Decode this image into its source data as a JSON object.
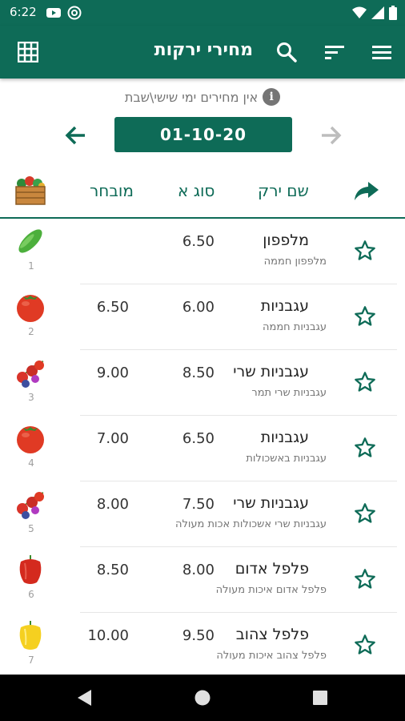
{
  "status_bar": {
    "time": "6:22",
    "icons_left": [
      "youtube-icon",
      "at-sign-icon"
    ],
    "icons_right": [
      "wifi-icon",
      "cellular-signal-icon",
      "battery-icon"
    ]
  },
  "app_bar": {
    "title": "מחירי ירקות",
    "icons": [
      "grid-icon",
      "search-icon",
      "sort-icon",
      "menu-icon"
    ],
    "color": "#0e6b57"
  },
  "notice": {
    "text": "אין מחירים ימי שישי\\שבת"
  },
  "date_nav": {
    "date": "01-10-20"
  },
  "table_header": {
    "col_name": "שם ירק",
    "col_grade_a": "סוג א",
    "col_selected": "מובחר"
  },
  "rows": [
    {
      "num": "1",
      "icon": "cucumber",
      "name": "מלפפון",
      "sub": "מלפפון חממה",
      "grade_a": "6.50",
      "selected": ""
    },
    {
      "num": "2",
      "icon": "tomato",
      "name": "עגבניות",
      "sub": "עגבניות חממה",
      "grade_a": "6.00",
      "selected": "6.50"
    },
    {
      "num": "3",
      "icon": "cherry-tomato",
      "name": "עגבניות שרי",
      "sub": "עגבניות שרי תמר",
      "grade_a": "8.50",
      "selected": "9.00"
    },
    {
      "num": "4",
      "icon": "tomato",
      "name": "עגבניות",
      "sub": "עגבניות באשכולות",
      "grade_a": "6.50",
      "selected": "7.00"
    },
    {
      "num": "5",
      "icon": "cherry-tomato",
      "name": "עגבניות שרי",
      "sub": "עגבניות שרי אשכולות אכות מעולה",
      "grade_a": "7.50",
      "selected": "8.00"
    },
    {
      "num": "6",
      "icon": "red-pepper",
      "name": "פלפל אדום",
      "sub": "פלפל אדום איכות מעולה",
      "grade_a": "8.00",
      "selected": "8.50"
    },
    {
      "num": "7",
      "icon": "yellow-pepper",
      "name": "פלפל צהוב",
      "sub": "פלפל צהוב איכות מעולה",
      "grade_a": "9.50",
      "selected": "10.00"
    }
  ]
}
